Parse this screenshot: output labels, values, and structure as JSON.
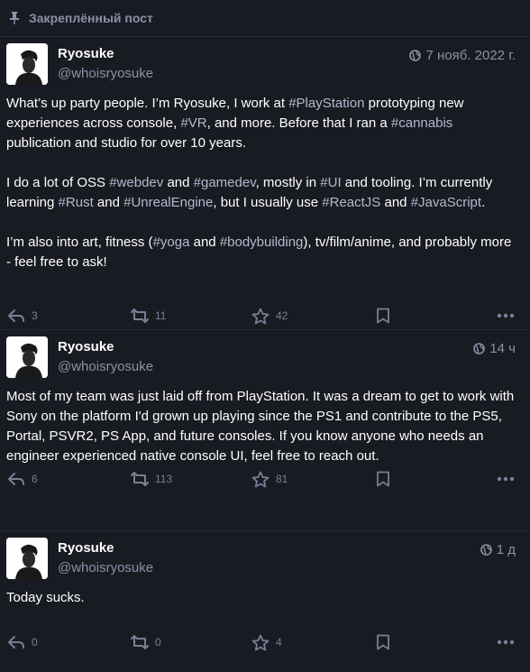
{
  "pinned": {
    "label": "Закреплённый пост"
  },
  "statuses": [
    {
      "display_name": "Ryosuke",
      "acct": "@whoisryosuke",
      "time": "7 нояб. 2022 г.",
      "paragraphs": [
        [
          {
            "t": "What’s up party people. I’m Ryosuke, I work at "
          },
          {
            "t": "#PlayStation",
            "tag": true
          },
          {
            "t": " prototyping new experiences across console, "
          },
          {
            "t": "#VR",
            "tag": true
          },
          {
            "t": ", and more. Before that I ran a "
          },
          {
            "t": "#cannabis",
            "tag": true
          },
          {
            "t": " publication and studio for over 10 years."
          }
        ],
        [
          {
            "t": "I do a lot of OSS "
          },
          {
            "t": "#webdev",
            "tag": true
          },
          {
            "t": " and "
          },
          {
            "t": "#gamedev",
            "tag": true
          },
          {
            "t": ", mostly in "
          },
          {
            "t": "#UI",
            "tag": true
          },
          {
            "t": " and tooling. I’m currently learning "
          },
          {
            "t": "#Rust",
            "tag": true
          },
          {
            "t": " and "
          },
          {
            "t": "#UnrealEngine",
            "tag": true
          },
          {
            "t": ", but I usually use "
          },
          {
            "t": "#ReactJS",
            "tag": true
          },
          {
            "t": " and "
          },
          {
            "t": "#JavaScript",
            "tag": true
          },
          {
            "t": "."
          }
        ],
        [
          {
            "t": "I’m also into art, fitness ("
          },
          {
            "t": "#yoga",
            "tag": true
          },
          {
            "t": " and "
          },
          {
            "t": "#bodybuilding",
            "tag": true
          },
          {
            "t": "), tv/film/anime, and probably more - feel free to ask!"
          }
        ]
      ],
      "replies": "3",
      "boosts": "11",
      "favs": "42"
    },
    {
      "display_name": "Ryosuke",
      "acct": "@whoisryosuke",
      "time": "14 ч",
      "paragraphs": [
        [
          {
            "t": "Most of my team was just laid off from PlayStation. It was a dream to get to work with Sony on the platform I'd grown up playing since the PS1 and contribute to the PS5, Portal, PSVR2, PS App, and future consoles. If you know anyone who needs an engineer experienced native console UI, feel free to reach out."
          }
        ]
      ],
      "replies": "6",
      "boosts": "113",
      "favs": "81"
    },
    {
      "display_name": "Ryosuke",
      "acct": "@whoisryosuke",
      "time": "1 д",
      "paragraphs": [
        [
          {
            "t": "Today sucks."
          }
        ]
      ],
      "replies": "0",
      "boosts": "0",
      "favs": "4"
    }
  ],
  "icons": {
    "pin": "pin-icon",
    "visibility": "globe-icon",
    "reply": "reply-icon",
    "boost": "boost-icon",
    "favourite": "star-icon",
    "bookmark": "bookmark-icon",
    "more": "ellipsis-icon"
  },
  "colors": {
    "background": "#191b22",
    "secondary_text": "#8d90a7",
    "hashtag": "#b5b8d0",
    "action_icon": "#7b7e96"
  }
}
